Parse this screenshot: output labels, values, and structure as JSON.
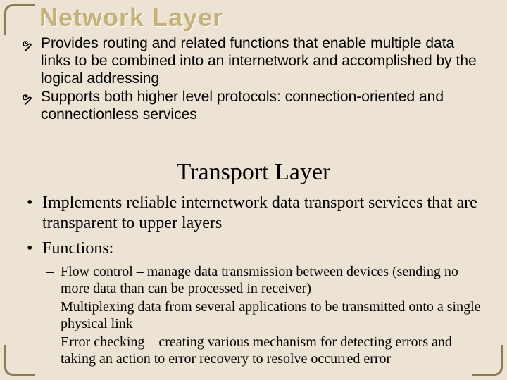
{
  "heading1": "Network Layer",
  "section1": {
    "items": [
      "Provides routing and related functions that enable multiple data links to be combined into an internetwork and accomplished by the logical addressing",
      "Supports both higher level protocols: connection-oriented and connectionless services"
    ]
  },
  "heading2": "Transport Layer",
  "section2": {
    "bullets": [
      "Implements reliable internetwork data transport services that are transparent to upper layers",
      "Functions:"
    ],
    "sub": [
      "Flow control – manage data transmission between devices (sending no more data than can be processed in receiver)",
      "Multiplexing data from several applications to be transmitted onto a single physical link",
      "Error checking – creating various mechanism for detecting errors and taking an action to error recovery to resolve occurred error"
    ]
  }
}
